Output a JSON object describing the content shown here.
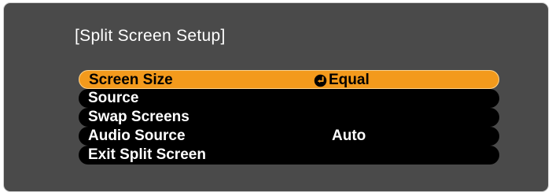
{
  "osd": {
    "title": "[Split Screen Setup]",
    "colors": {
      "panel_background": "#4a4a4a",
      "item_background": "#000000",
      "selected_background": "#f39a1c",
      "text": "#ffffff",
      "selected_text": "#000000"
    }
  },
  "menu": {
    "items": [
      {
        "label": "Screen Size",
        "value": "Equal",
        "icon": "enter-icon",
        "selected": true
      },
      {
        "label": "Source",
        "value": ""
      },
      {
        "label": "Swap Screens",
        "value": ""
      },
      {
        "label": "Audio Source",
        "value": "Auto"
      },
      {
        "label": "Exit Split Screen",
        "value": ""
      }
    ]
  }
}
